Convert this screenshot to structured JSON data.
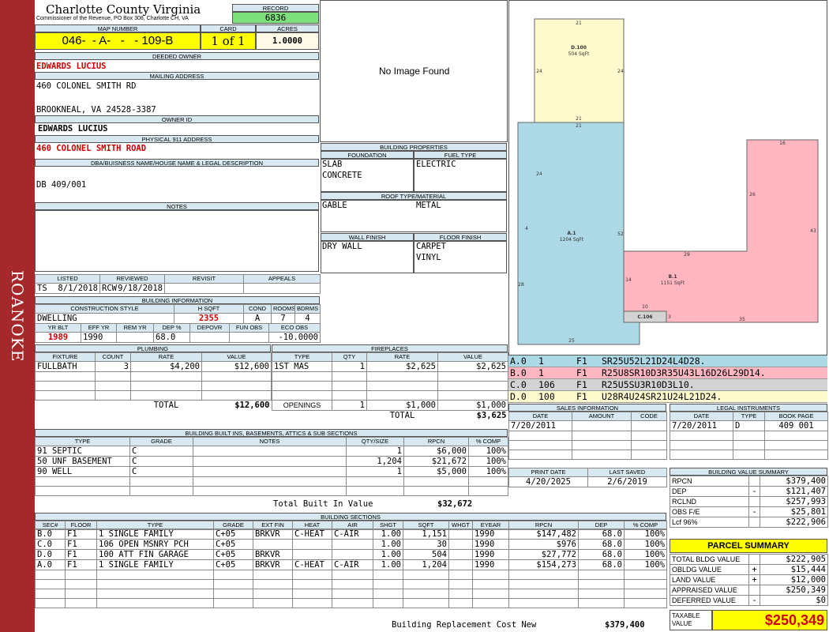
{
  "sidebar": {
    "label": "ROANOKE"
  },
  "header": {
    "county": "Charlotte County Virginia",
    "commissioner": "Commissioner of the Revenue, PO Box 308, Charlotte CH, VA"
  },
  "record": {
    "label": "RECORD",
    "value": "6836"
  },
  "map_number": {
    "label": "MAP NUMBER",
    "value": "046-  - A-   -   - 109-B"
  },
  "card": {
    "label": "CARD",
    "value": "1 of 1"
  },
  "acres": {
    "label": "ACRES",
    "value": "1.0000"
  },
  "deeded_owner": {
    "label": "DEEDED OWNER",
    "value": "EDWARDS LUCIUS"
  },
  "mailing": {
    "label": "MAILING ADDRESS",
    "line1": "460 COLONEL SMITH RD",
    "line2": "BROOKNEAL, VA 24528-3387"
  },
  "owner_id": {
    "label": "OWNER ID",
    "value": "EDWARDS LUCIUS"
  },
  "physical": {
    "label": "PHYSICAL 911 ADDRESS",
    "value": "460 COLONEL SMITH ROAD"
  },
  "dba": {
    "label": "DBA/BUISNESS NAME/HOUSE NAME & LEGAL DESCRIPTION",
    "value": "DB 409/001"
  },
  "notes": {
    "label": "NOTES"
  },
  "image": {
    "placeholder": "No Image Found"
  },
  "building_properties": {
    "label": "BUILDING PROPERTIES",
    "foundation_label": "FOUNDATION",
    "fuel_label": "FUEL TYPE",
    "foundation": [
      "SLAB",
      "CONCRETE"
    ],
    "fuel": "ELECTRIC",
    "roof_label": "ROOF TYPE/MATERIAL",
    "roof_type": "GABLE",
    "roof_material": "METAL",
    "wall_label": "WALL FINISH",
    "floor_label": "FLOOR FINISH",
    "wall": "DRY WALL",
    "floor": [
      "CARPET",
      "VINYL"
    ]
  },
  "listing": {
    "listed_label": "LISTED",
    "reviewed_label": "REVIEWED",
    "revisit_label": "REVISIT",
    "appeals_label": "APPEALS",
    "listed_by": "TS",
    "listed_date": "8/1/2018",
    "reviewed_by": "RCW",
    "reviewed_date": "9/18/2018"
  },
  "building_info": {
    "label": "BUILDING INFORMATION",
    "h": [
      "CONSTRUCTION STYLE",
      "H SQFT",
      "COND",
      "ROOMS",
      "BDRMS"
    ],
    "v": [
      "DWELLING",
      "2355",
      "A",
      "7",
      "4"
    ],
    "h2": [
      "YR BLT",
      "EFF YR",
      "REM YR",
      "DEP %",
      "DEPOVR",
      "FUN OBS",
      "ECO OBS"
    ],
    "v2": [
      "1989",
      "1990",
      "",
      "68.0",
      "",
      "",
      "-10.0000"
    ]
  },
  "plumbing": {
    "label": "PLUMBING",
    "h": [
      "FIXTURE",
      "COUNT",
      "RATE",
      "VALUE"
    ],
    "rows": [
      [
        "FULLBATH",
        "3",
        "$4,200",
        "$12,600"
      ]
    ],
    "total_label": "TOTAL",
    "total": "$12,600"
  },
  "fireplaces": {
    "label": "FIREPLACES",
    "h": [
      "TYPE",
      "QTY",
      "RATE",
      "VALUE"
    ],
    "rows": [
      [
        "1ST MAS",
        "1",
        "$2,625",
        "$2,625"
      ]
    ],
    "openings_label": "OPENINGS",
    "openings": [
      "1",
      "$1,000",
      "$1,000"
    ],
    "total_label": "TOTAL",
    "total": "$3,625"
  },
  "builtins": {
    "label": "BUILDING BUILT INS, BASEMENTS, ATTICS & SUB SECTIONS",
    "h": [
      "TYPE",
      "GRADE",
      "NOTES",
      "QTY/SIZE",
      "RPCN",
      "% COMP"
    ],
    "rows": [
      [
        "91 SEPTIC",
        "C",
        "",
        "1",
        "$6,000",
        "100%"
      ],
      [
        "50 UNF BASEMENT",
        "C",
        "",
        "1,204",
        "$21,672",
        "100%"
      ],
      [
        "90 WELL",
        "C",
        "",
        "1",
        "$5,000",
        "100%"
      ]
    ],
    "total_label": "Total Built In Value",
    "total": "$32,672"
  },
  "sections": {
    "label": "BUILDING SECTIONS",
    "h": [
      "SEC#",
      "FLOOR",
      "TYPE",
      "GRADE",
      "EXT FIN",
      "HEAT",
      "AIR",
      "SHGT",
      "SQFT",
      "WHGT",
      "EYEAR",
      "RPCN",
      "DEP",
      "% COMP"
    ],
    "rows": [
      [
        "B.0",
        "F1",
        "1 SINGLE FAMILY",
        "C+05",
        "BRKVR",
        "C-HEAT",
        "C-AIR",
        "1.00",
        "1,151",
        "",
        "1990",
        "$147,482",
        "68.0",
        "100%"
      ],
      [
        "C.0",
        "F1",
        "106 OPEN MSNRY PCH",
        "C+05",
        "",
        "",
        "",
        "1.00",
        "30",
        "",
        "1990",
        "$976",
        "68.0",
        "100%"
      ],
      [
        "D.0",
        "F1",
        "100 ATT FIN GARAGE",
        "C+05",
        "BRKVR",
        "",
        "",
        "1.00",
        "504",
        "",
        "1990",
        "$27,772",
        "68.0",
        "100%"
      ],
      [
        "A.0",
        "F1",
        "1 SINGLE FAMILY",
        "C+05",
        "BRKVR",
        "C-HEAT",
        "C-AIR",
        "1.00",
        "1,204",
        "",
        "1990",
        "$154,273",
        "68.0",
        "100%"
      ]
    ],
    "total_label": "Building Replacement Cost New",
    "total": "$379,400"
  },
  "sketch": {
    "labels": [
      {
        "k": "D.100",
        "a": "504 SqFt"
      },
      {
        "k": "A.1",
        "a": "1204 SqFt"
      },
      {
        "k": "B.1",
        "a": "1151 SqFt"
      },
      {
        "k": "C.106",
        "a": ""
      }
    ],
    "dims": [
      "21",
      "24",
      "24",
      "21",
      "21",
      "24",
      "4",
      "52",
      "28",
      "25",
      "26",
      "16",
      "43",
      "29",
      "14",
      "10",
      "3",
      "35"
    ]
  },
  "legend": [
    {
      "code": "A.0",
      "n": "1",
      "f": "F1",
      "path": "SR25U52L21D24L4D28.",
      "color": "#add8e6"
    },
    {
      "code": "B.0",
      "n": "1",
      "f": "F1",
      "path": "R25U8SR10D3R35U43L16D26L29D14.",
      "color": "#ffb6c1"
    },
    {
      "code": "C.0",
      "n": "106",
      "f": "F1",
      "path": "R25U5SU3R10D3L10.",
      "color": "#d3d3d3"
    },
    {
      "code": "D.0",
      "n": "100",
      "f": "F1",
      "path": "U28R4U24SR21U24L21D24.",
      "color": "#fffacd"
    }
  ],
  "sales": {
    "label": "SALES INFORMATION",
    "h": [
      "DATE",
      "AMOUNT",
      "CODE"
    ],
    "rows": [
      [
        "7/20/2011",
        "",
        ""
      ]
    ]
  },
  "legal": {
    "label": "LEGAL INSTRUMENTS",
    "h": [
      "DATE",
      "TYPE",
      "BOOK PAGE"
    ],
    "rows": [
      [
        "7/20/2011",
        "D",
        "409 001"
      ]
    ]
  },
  "print": {
    "print_label": "PRINT DATE",
    "saved_label": "LAST SAVED",
    "print_date": "4/20/2025",
    "saved_date": "2/6/2019"
  },
  "value_summary": {
    "label": "BUILDING VALUE SUMMARY",
    "rows": [
      [
        "RPCN",
        "",
        "$379,400"
      ],
      [
        "DEP",
        "-",
        "$121,407"
      ],
      [
        "RCLND",
        "",
        "$257,993"
      ],
      [
        "OBS F/E",
        "-",
        "$25,801"
      ],
      [
        "Lcf  96%",
        "",
        "$222,906"
      ]
    ]
  },
  "parcel": {
    "label": "PARCEL SUMMARY",
    "rows": [
      [
        "TOTAL BLDG VALUE",
        "",
        "$222,905"
      ],
      [
        "OBLDG VALUE",
        "+",
        "$15,444"
      ],
      [
        "LAND VALUE",
        "+",
        "$12,000"
      ],
      [
        "APPRAISED VALUE",
        "",
        "$250,349"
      ],
      [
        "DEFERRED VALUE",
        "-",
        "$0"
      ]
    ],
    "taxable_label": "TAXABLE VALUE",
    "taxable": "$250,349"
  }
}
